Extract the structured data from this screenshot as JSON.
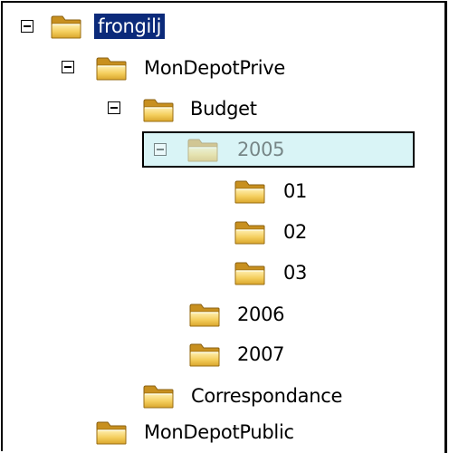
{
  "tree": {
    "root": {
      "label": "frongilj"
    },
    "mondepotprive": {
      "label": "MonDepotPrive"
    },
    "budget": {
      "label": "Budget"
    },
    "y2005": {
      "label": "2005"
    },
    "m01": {
      "label": "01"
    },
    "m02": {
      "label": "02"
    },
    "m03": {
      "label": "03"
    },
    "y2006": {
      "label": "2006"
    },
    "y2007": {
      "label": "2007"
    },
    "correspondance": {
      "label": "Correspondance"
    },
    "mondepotpublic": {
      "label": "MonDepotPublic"
    }
  },
  "colors": {
    "selection_bg": "#0b2a7a",
    "drag_highlight_bg": "#d9f4f6",
    "folder_fill": "#f2c84b"
  }
}
